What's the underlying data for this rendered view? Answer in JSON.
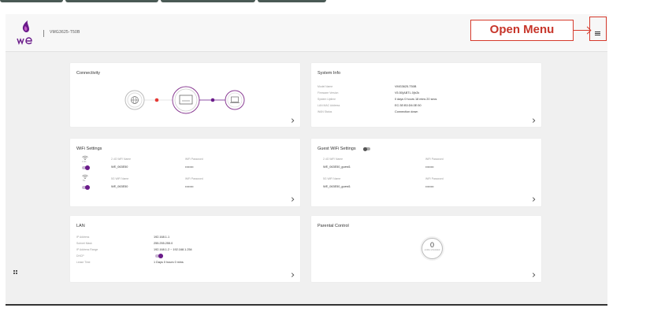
{
  "header": {
    "model": "VMG3625-T50B",
    "callout_label": "Open Menu"
  },
  "icons": {
    "logo": "we-logo",
    "menu": "hamburger-icon",
    "grid": "grid-icon",
    "chevron": "›"
  },
  "colors": {
    "accent": "#6a1b8a",
    "callout": "#d63a2c",
    "status_dot": "#e53935"
  },
  "connectivity": {
    "title": "Connectivity"
  },
  "system_info": {
    "title": "System Info",
    "rows": [
      {
        "label": "Model Name",
        "value": "VMG3625-T50B"
      },
      {
        "label": "Firmware Version",
        "value": "V5.50(ABTL.0)b2k"
      },
      {
        "label": "System Uptime",
        "value": "0 days 0 hours 18 mins 20 secs"
      },
      {
        "label": "LAN MAC Address",
        "value": "EC:3E:B3:D6:3E:50"
      },
      {
        "label": "WAN Status",
        "value": "Connection down"
      }
    ]
  },
  "wifi_settings": {
    "title": "WiFi Settings",
    "bands": [
      {
        "band": "2.4G",
        "name_label": "2.4G WiFi Name",
        "name": "WE_063E50",
        "pw_label": "WiFi Password",
        "password": "••••••••"
      },
      {
        "band": "5G",
        "name_label": "5G WiFi Name",
        "name": "WE_063E50",
        "pw_label": "WiFi Password",
        "password": "••••••••"
      }
    ]
  },
  "guest_wifi": {
    "title": "Guest WiFi Settings",
    "bands": [
      {
        "name_label": "2.4G WiFi Name",
        "name": "WE_063E50_guest1",
        "pw_label": "WiFi Password",
        "password": "••••••••"
      },
      {
        "name_label": "5G WiFi Name",
        "name": "WE_063E50_guest1",
        "pw_label": "WiFi Password",
        "password": "••••••••"
      }
    ]
  },
  "lan": {
    "title": "LAN",
    "rows": [
      {
        "label": "IP Address",
        "value": "192.168.1.1"
      },
      {
        "label": "Subnet Mask",
        "value": "255.255.255.0"
      },
      {
        "label": "IP Address Range",
        "value": "192.168.1.2 ~ 192.168.1.254"
      },
      {
        "label": "DHCP",
        "value": ""
      },
      {
        "label": "Lease Time",
        "value": "1 Days 0 hours 0 mins"
      }
    ]
  },
  "parental_control": {
    "title": "Parental Control",
    "count": "0",
    "count_label": "profile scheduled"
  }
}
